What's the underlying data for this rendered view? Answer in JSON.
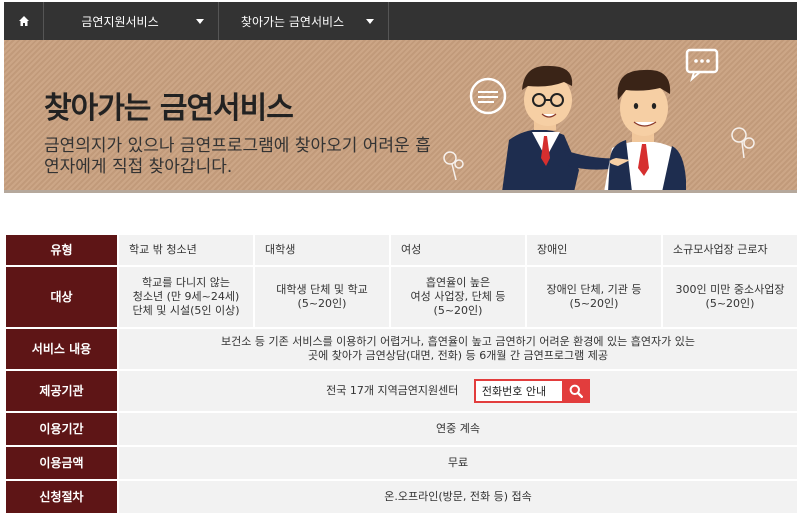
{
  "nav": {
    "home_icon": "home-icon",
    "dropdown1": "금연지원서비스",
    "dropdown2": "찾아가는 금연서비스"
  },
  "banner": {
    "title": "찾아가는 금연서비스",
    "description": "금연의지가 있으나 금연프로그램에 찾아오기 어려운 흡연자에게 직접 찾아갑니다.",
    "bg_color": "#c9a07f"
  },
  "table": {
    "header_color": "#5e1516",
    "rows": {
      "type": {
        "label": "유형",
        "cells": [
          "학교 밖 청소년",
          "대학생",
          "여성",
          "장애인",
          "소규모사업장 근로자"
        ]
      },
      "target": {
        "label": "대상",
        "cells": [
          "학교를 다니지 않는\n청소년 (만 9세~24세)\n단체 및 시설(5인 이상)",
          "대학생 단체 및 학교\n(5~20인)",
          "흡연율이 높은\n여성 사업장, 단체 등\n(5~20인)",
          "장애인 단체, 기관 등\n(5~20인)",
          "300인 미만 중소사업장\n(5~20인)"
        ]
      },
      "service": {
        "label": "서비스 내용",
        "value": "보건소 등 기존 서비스를 이용하기 어렵거나, 흡연율이 높고 금연하기 어려운 환경에 있는 흡연자가 있는\n곳에 찾아가 금연상담(대면, 전화) 등 6개월 간 금연프로그램 제공"
      },
      "provider": {
        "label": "제공기관",
        "value": "전국 17개 지역금연지원센터",
        "search_value": "전화번호 안내",
        "search_icon": "search-icon"
      },
      "period": {
        "label": "이용기간",
        "value": "연중 계속"
      },
      "fee": {
        "label": "이용금액",
        "value": "무료"
      },
      "procedure": {
        "label": "신청절차",
        "value": "온.오프라인(방문, 전화 등) 접속"
      }
    }
  }
}
